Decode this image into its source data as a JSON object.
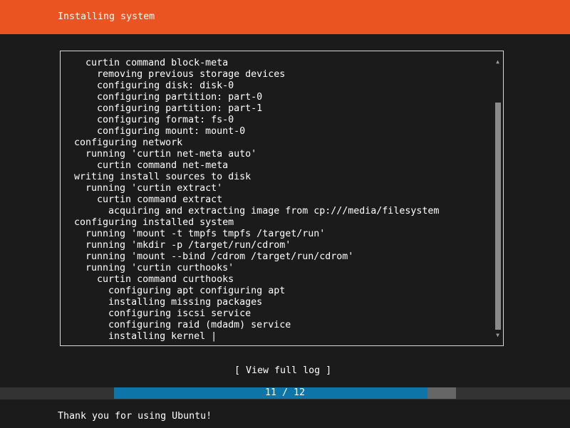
{
  "header": {
    "title": "Installing system",
    "color": "#e95420"
  },
  "log": {
    "lines": [
      "    curtin command block-meta",
      "      removing previous storage devices",
      "      configuring disk: disk-0",
      "      configuring partition: part-0",
      "      configuring partition: part-1",
      "      configuring format: fs-0",
      "      configuring mount: mount-0",
      "  configuring network",
      "    running 'curtin net-meta auto'",
      "      curtin command net-meta",
      "  writing install sources to disk",
      "    running 'curtin extract'",
      "      curtin command extract",
      "        acquiring and extracting image from cp:///media/filesystem",
      "  configuring installed system",
      "    running 'mount -t tmpfs tmpfs /target/run'",
      "    running 'mkdir -p /target/run/cdrom'",
      "    running 'mount --bind /cdrom /target/run/cdrom'",
      "    running 'curtin curthooks'",
      "      curtin command curthooks",
      "        configuring apt configuring apt",
      "        installing missing packages",
      "        configuring iscsi service",
      "        configuring raid (mdadm) service",
      "        installing kernel"
    ],
    "spinner": "|",
    "scroll_up_icon": "triangle-up",
    "scroll_down_icon": "triangle-down"
  },
  "actions": {
    "view_full_log": "[ View full log ]"
  },
  "progress": {
    "current": 11,
    "total": 12,
    "label": "11 / 12",
    "fill_color": "#0d75a8"
  },
  "footer": {
    "message": "Thank you for using Ubuntu!"
  }
}
